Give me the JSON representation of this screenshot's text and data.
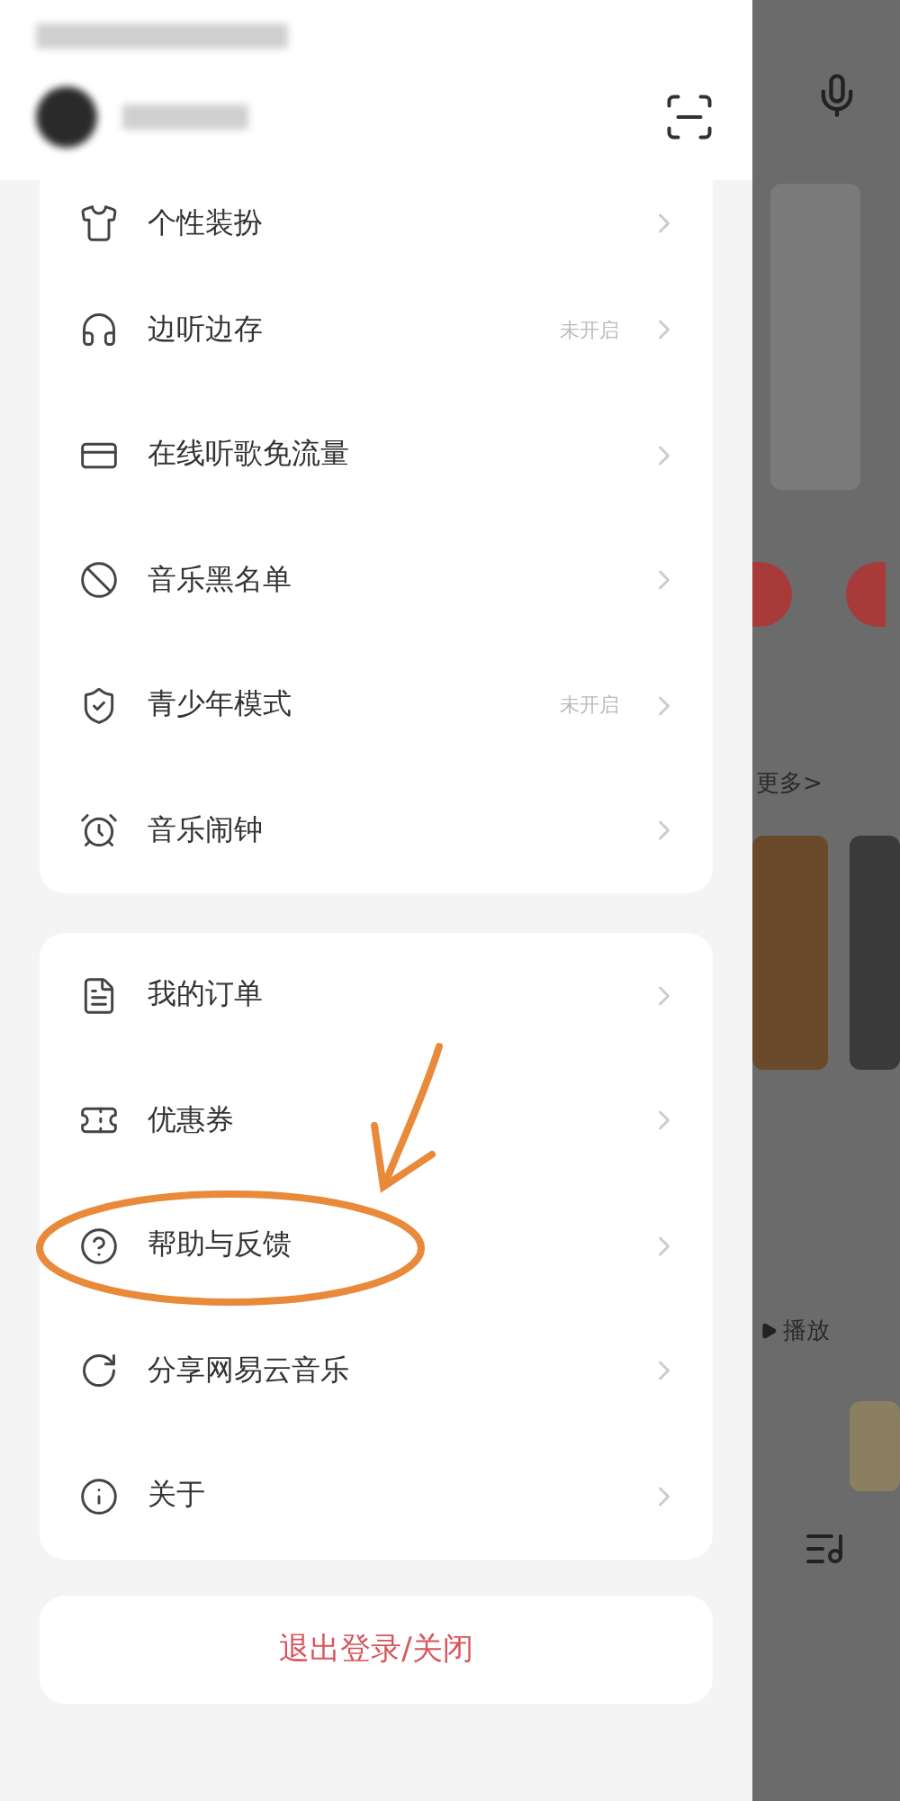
{
  "drawer": {
    "sections": [
      {
        "items": [
          {
            "label": "个性装扮",
            "circled": false
          },
          {
            "label": "边听边存",
            "status": "未开启",
            "circled": false
          },
          {
            "label": "在线听歌免流量",
            "circled": false
          },
          {
            "label": "音乐黑名单",
            "circled": false
          },
          {
            "label": "青少年模式",
            "status": "未开启",
            "circled": false
          },
          {
            "label": "音乐闹钟",
            "circled": false
          }
        ]
      },
      {
        "items": [
          {
            "label": "我的订单",
            "circled": false
          },
          {
            "label": "优惠券",
            "circled": false
          },
          {
            "label": "帮助与反馈",
            "circled": true
          },
          {
            "label": "分享网易云音乐",
            "circled": false
          },
          {
            "label": "关于",
            "circled": false
          }
        ]
      }
    ],
    "logout": "退出登录/关闭"
  },
  "background_app": {
    "more_link": "更多>",
    "play_label": "播放"
  }
}
